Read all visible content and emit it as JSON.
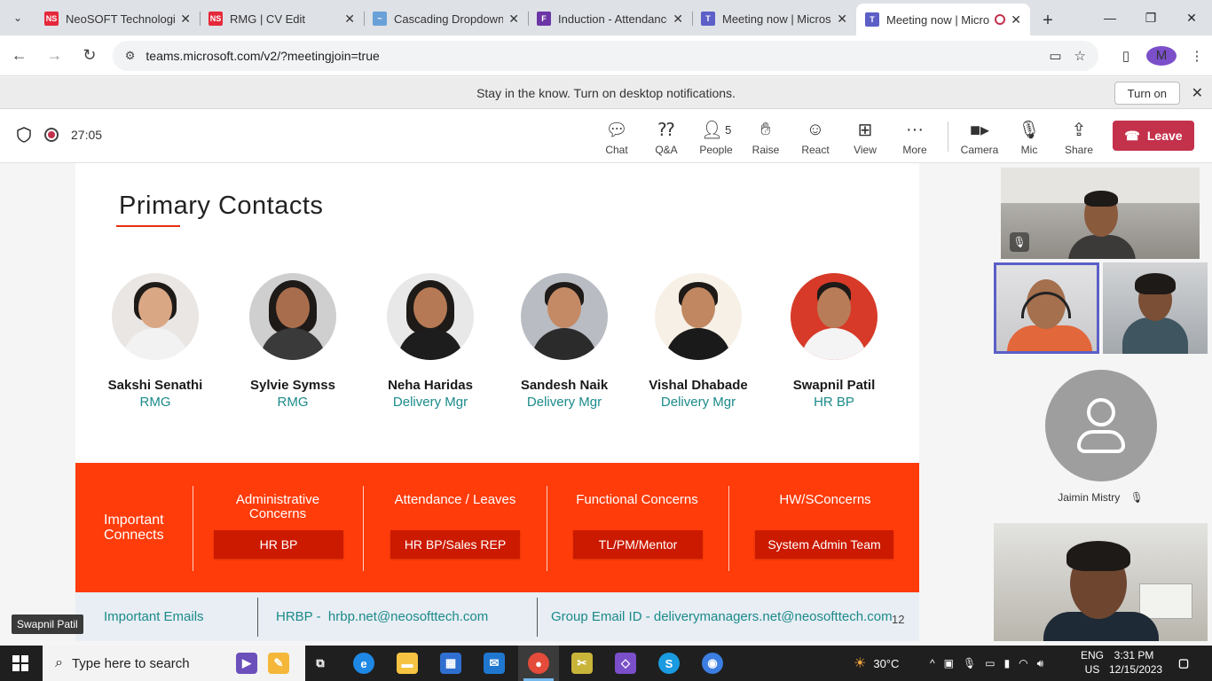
{
  "browser": {
    "tabs": [
      {
        "title": "NeoSOFT Technologies",
        "favicon": "NS",
        "color": "#e5283a"
      },
      {
        "title": "RMG | CV Edit",
        "favicon": "NS",
        "color": "#e5283a"
      },
      {
        "title": "Cascading Dropdown",
        "favicon": "~",
        "color": "#6aa0d8"
      },
      {
        "title": "Induction - Attendance",
        "favicon": "F",
        "color": "#6b35a6"
      },
      {
        "title": "Meeting now | Microsoft Teams",
        "favicon": "T",
        "color": "#5b5fc7"
      },
      {
        "title": "Meeting now | Microsoft Teams",
        "favicon": "T",
        "color": "#5b5fc7"
      }
    ],
    "url": "teams.microsoft.com/v2/?meetingjoin=true",
    "profile_initial": "M"
  },
  "notification": {
    "text": "Stay in the know. Turn on desktop notifications.",
    "button": "Turn on"
  },
  "meeting": {
    "timer": "27:05",
    "people_count": "5",
    "toolbar": [
      {
        "label": "Chat",
        "icon": "chat-icon"
      },
      {
        "label": "Q&A",
        "icon": "qa-icon"
      },
      {
        "label": "People",
        "icon": "people-icon"
      },
      {
        "label": "Raise",
        "icon": "raise-hand-icon"
      },
      {
        "label": "React",
        "icon": "react-icon"
      },
      {
        "label": "View",
        "icon": "view-icon"
      },
      {
        "label": "More",
        "icon": "more-icon"
      },
      {
        "label": "Camera",
        "icon": "camera-icon"
      },
      {
        "label": "Mic",
        "icon": "mic-off-icon"
      },
      {
        "label": "Share",
        "icon": "share-icon"
      }
    ],
    "leave_label": "Leave",
    "presenter_name": "Swapnil Patil"
  },
  "slide": {
    "title": "Primary Contacts",
    "contacts": [
      {
        "name": "Sakshi Senathi",
        "role": "RMG"
      },
      {
        "name": "Sylvie Symss",
        "role": "RMG"
      },
      {
        "name": "Neha Haridas",
        "role": "Delivery Mgr"
      },
      {
        "name": "Sandesh Naik",
        "role": "Delivery Mgr"
      },
      {
        "name": "Vishal Dhabade",
        "role": "Delivery Mgr"
      },
      {
        "name": "Swapnil Patil",
        "role": "HR BP"
      }
    ],
    "connects_label": "Important Connects",
    "connects": [
      {
        "heading": "Administrative Concerns",
        "contact": "HR BP"
      },
      {
        "heading": "Attendance / Leaves",
        "contact": "HR BP/Sales REP"
      },
      {
        "heading": "Functional Concerns",
        "contact": "TL/PM/Mentor"
      },
      {
        "heading": "HW/SConcerns",
        "contact": "System Admin Team"
      }
    ],
    "emails_label": "Important Emails",
    "hrbp_email": "HRBP -  hrbp.net@neosofttech.com",
    "group_email": "Group Email ID - deliverymanagers.net@neosofttech.com",
    "page_number": "12",
    "accent_color": "#ff3c0a"
  },
  "participants": {
    "jaimin_name": "Jaimin Mistry"
  },
  "taskbar": {
    "search_placeholder": "Type here to search",
    "weather": "30°C",
    "lang_top": "ENG",
    "lang_bottom": "US",
    "time": "3:31 PM",
    "date": "12/15/2023"
  }
}
